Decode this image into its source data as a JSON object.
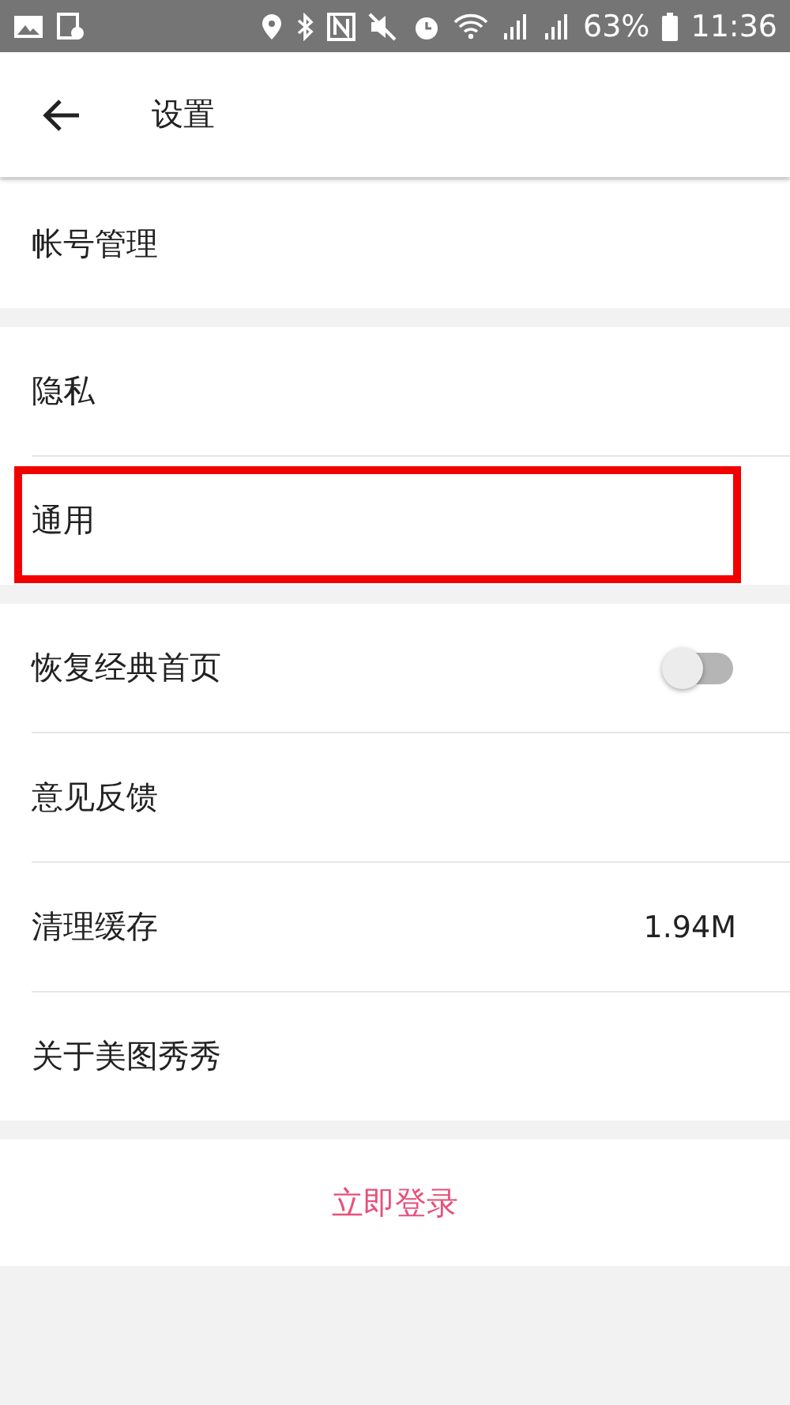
{
  "status_bar": {
    "battery": "63%",
    "time": "11:36"
  },
  "header": {
    "title": "设置"
  },
  "groups": [
    {
      "items": [
        {
          "kind": "plain",
          "label": "帐号管理",
          "highlighted": false
        }
      ]
    },
    {
      "items": [
        {
          "kind": "plain",
          "label": "隐私",
          "highlighted": false
        },
        {
          "kind": "plain",
          "label": "通用",
          "highlighted": true
        }
      ]
    },
    {
      "items": [
        {
          "kind": "toggle",
          "label": "恢复经典首页",
          "on": false,
          "highlighted": false
        },
        {
          "kind": "plain",
          "label": "意见反馈",
          "highlighted": false
        },
        {
          "kind": "value",
          "label": "清理缓存",
          "value": "1.94M",
          "highlighted": false
        },
        {
          "kind": "plain",
          "label": "关于美图秀秀",
          "highlighted": false
        }
      ]
    }
  ],
  "login_button": {
    "label": "立即登录"
  }
}
